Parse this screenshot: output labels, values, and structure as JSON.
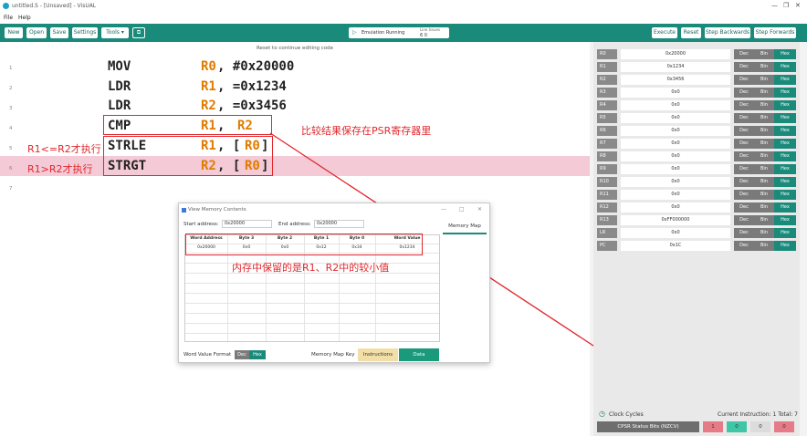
{
  "window": {
    "title": "untitled.S - [Unsaved] - VisUAL"
  },
  "menu": [
    "File",
    "Help"
  ],
  "toolbar": {
    "new": "New",
    "open": "Open",
    "save": "Save",
    "settings": "Settings",
    "tools": "Tools ▾",
    "emulation": "Emulation Running",
    "line_issues_label": "Line Issues",
    "line_issues_value": "6   0",
    "execute": "Execute",
    "reset": "Reset",
    "step_back": "Step Backwards",
    "step_fwd": "Step Forwards"
  },
  "editor": {
    "reset_message": "Reset to continue editing code",
    "lines": [
      {
        "num": "1",
        "mnemonic": "MOV",
        "reg": "R0",
        "rest": ", #0x20000"
      },
      {
        "num": "2",
        "mnemonic": "LDR",
        "reg": "R1",
        "rest": ", =0x1234"
      },
      {
        "num": "3",
        "mnemonic": "LDR",
        "reg": "R2",
        "rest": ", =0x3456"
      },
      {
        "num": "4",
        "mnemonic": "CMP",
        "reg": "R1",
        "rest": ", ",
        "reg2": "R2"
      },
      {
        "num": "5",
        "mnemonic": "STRLE",
        "reg": "R1",
        "rest": ", [",
        "reg2": "R0",
        "close": "]"
      },
      {
        "num": "6",
        "mnemonic": "STRGT",
        "reg": "R2",
        "rest": ", [",
        "reg2": "R0",
        "close": "]"
      },
      {
        "num": "7"
      }
    ],
    "annotations": {
      "cmp_note": "比较结果保存在PSR寄存器里",
      "le_note": "R1<=R2才执行",
      "gt_note": "R1>R2才执行",
      "mem_note": "内存中保留的是R1、R2中的较小值"
    }
  },
  "registers": [
    {
      "name": "R0",
      "value": "0x20000"
    },
    {
      "name": "R1",
      "value": "0x1234"
    },
    {
      "name": "R2",
      "value": "0x3456"
    },
    {
      "name": "R3",
      "value": "0x0"
    },
    {
      "name": "R4",
      "value": "0x0"
    },
    {
      "name": "R5",
      "value": "0x0"
    },
    {
      "name": "R6",
      "value": "0x0"
    },
    {
      "name": "R7",
      "value": "0x0"
    },
    {
      "name": "R8",
      "value": "0x0"
    },
    {
      "name": "R9",
      "value": "0x0"
    },
    {
      "name": "R10",
      "value": "0x0"
    },
    {
      "name": "R11",
      "value": "0x0"
    },
    {
      "name": "R12",
      "value": "0x0"
    },
    {
      "name": "R13",
      "value": "0xFF000000"
    },
    {
      "name": "LR",
      "value": "0x0"
    },
    {
      "name": "PC",
      "value": "0x1C"
    }
  ],
  "reg_formats": {
    "dec": "Dec",
    "bin": "Bin",
    "hex": "Hex"
  },
  "status": {
    "clock_cycles": "Clock Cycles",
    "current_instruction": "Current Instruction:  1   Total:  7",
    "cpsr_label": "CPSR Status Bits (NZCV)",
    "flags": [
      "1",
      "0",
      "0",
      "0"
    ]
  },
  "memory_dialog": {
    "title": "View Memory Contents",
    "start_label": "Start address:",
    "start_value": "0x20000",
    "end_label": "End address:",
    "end_value": "0x20000",
    "tab": "Memory Map",
    "columns": [
      "Word Address",
      "Byte 3",
      "Byte 2",
      "Byte 1",
      "Byte 0",
      "Word Value"
    ],
    "rows": [
      [
        "0x20000",
        "0x0",
        "0x0",
        "0x12",
        "0x34",
        "0x1234"
      ]
    ],
    "format_label": "Word Value Format",
    "fmt_dec": "Dec",
    "fmt_hex": "Hex",
    "key_label": "Memory Map Key",
    "key_instructions": "Instructions",
    "key_data": "Data"
  },
  "colors": {
    "accent": "#1a8a7a",
    "annotation": "#e0282d",
    "register_name": "#e07b00",
    "highlight_row": "#f3cad6"
  }
}
